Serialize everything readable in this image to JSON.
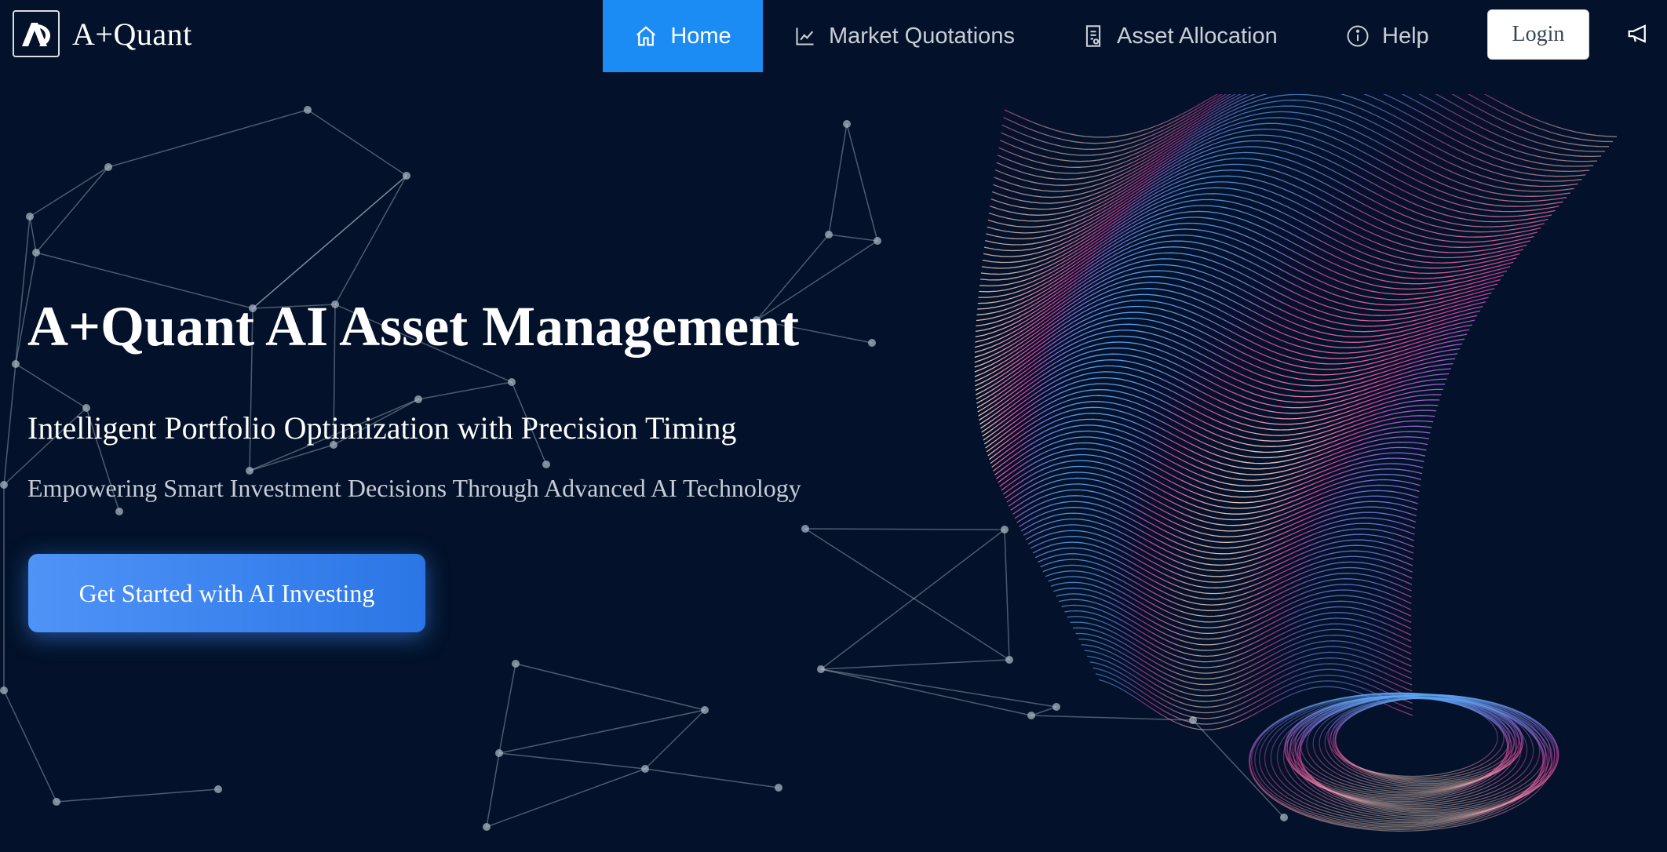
{
  "brand": {
    "name": "A+Quant"
  },
  "nav": {
    "items": [
      {
        "label": "Home",
        "icon": "home-icon",
        "active": true
      },
      {
        "label": "Market Quotations",
        "icon": "line-chart-icon",
        "active": false
      },
      {
        "label": "Asset Allocation",
        "icon": "document-icon",
        "active": false
      },
      {
        "label": "Help",
        "icon": "info-icon",
        "active": false
      }
    ],
    "login_label": "Login",
    "announcement_icon": "megaphone-icon"
  },
  "hero": {
    "title": "A+Quant AI Asset Management",
    "subtitle": "Intelligent Portfolio Optimization with Precision Timing",
    "tagline": "Empowering Smart Investment Decisions Through Advanced AI Technology",
    "cta_label": "Get Started with AI Investing"
  },
  "colors": {
    "background": "#03122a",
    "nav_active": "#1c8cf5",
    "cta": "#3a86f0",
    "wave_top": "#5aa6f5",
    "wave_mid": "#e0409a",
    "wave_bottom": "#f8d4c0"
  }
}
